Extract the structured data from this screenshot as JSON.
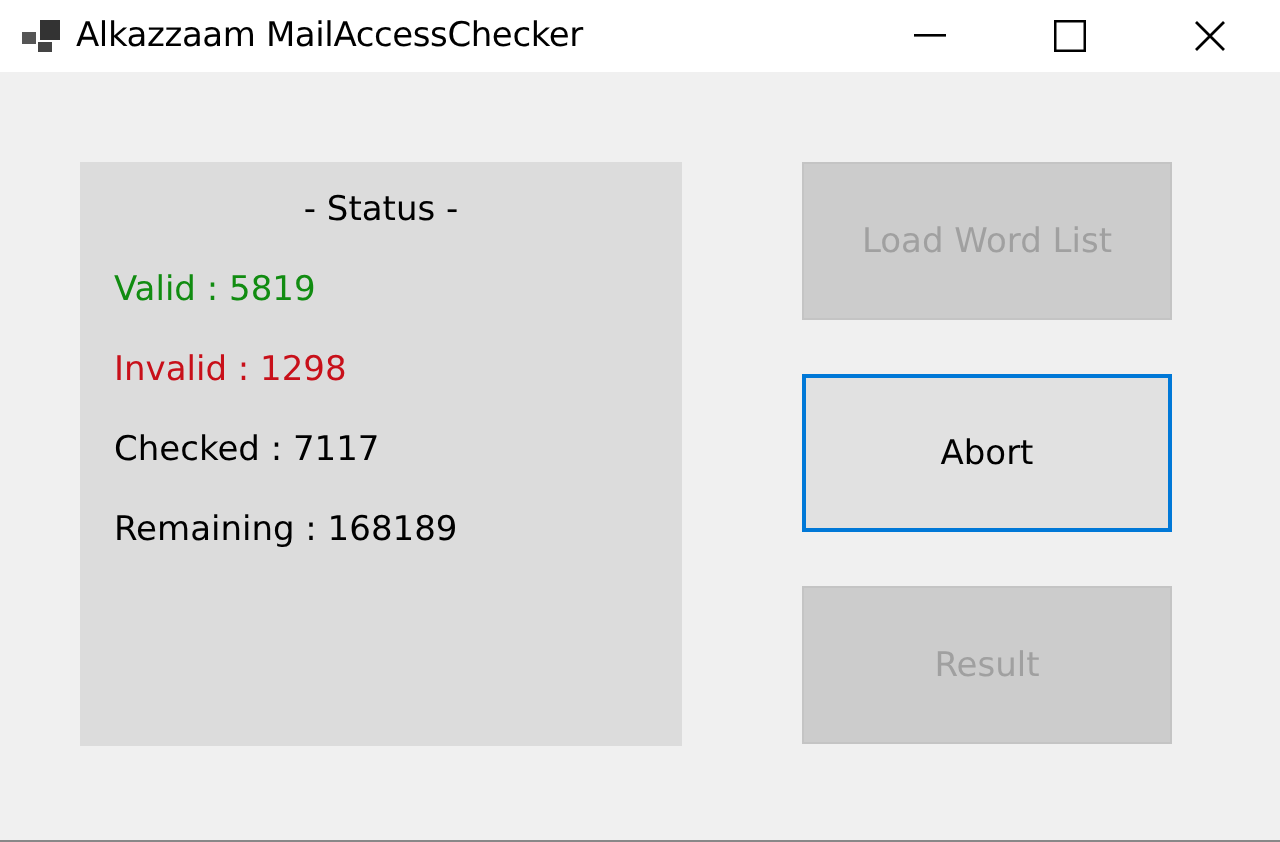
{
  "window": {
    "title": "Alkazzaam MailAccessChecker"
  },
  "status": {
    "heading": "- Status -",
    "lines": [
      {
        "text": "Valid : 5819",
        "color": "#118c11"
      },
      {
        "text": "Invalid : 1298",
        "color": "#c8101a"
      },
      {
        "text": "Checked : 7117",
        "color": "#000000"
      },
      {
        "text": "Remaining : 168189",
        "color": "#000000"
      }
    ]
  },
  "buttons": [
    {
      "label": "Load Word List",
      "disabled": true,
      "focused": false
    },
    {
      "label": "Abort",
      "disabled": false,
      "focused": true
    },
    {
      "label": "Result",
      "disabled": true,
      "focused": false
    }
  ]
}
